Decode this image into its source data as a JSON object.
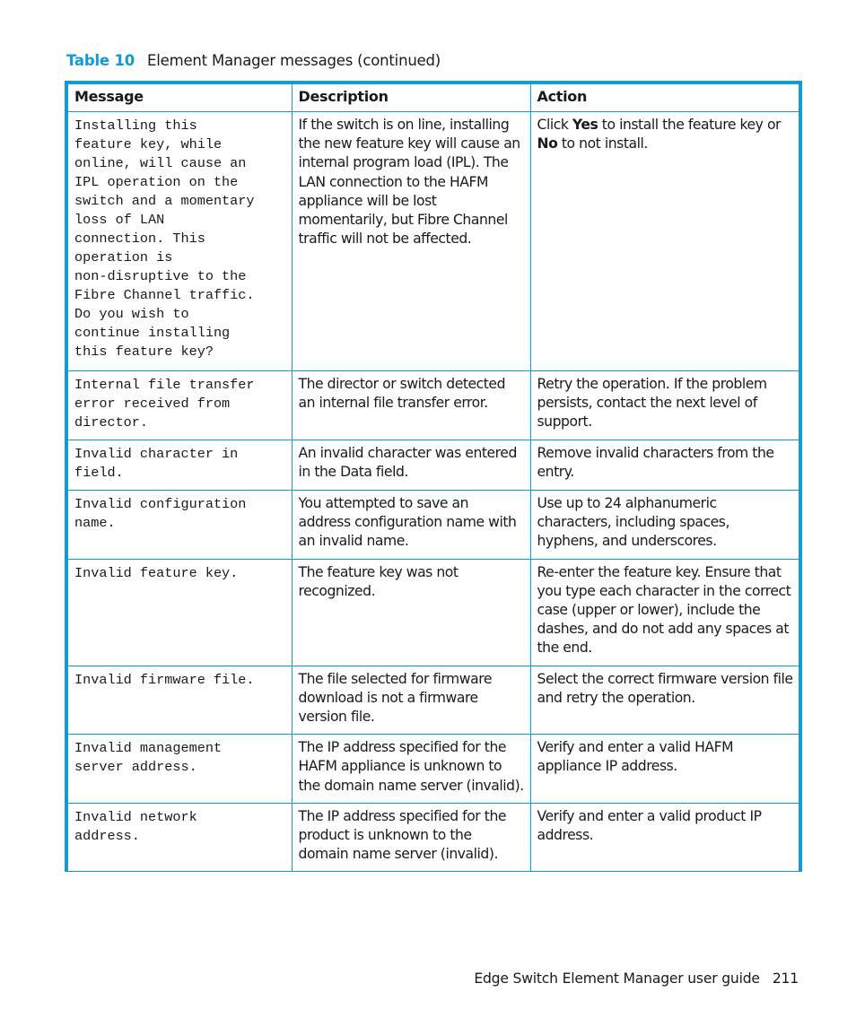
{
  "caption": {
    "table_number": "Table 10",
    "title": "Element Manager messages (continued)"
  },
  "table": {
    "headers": [
      "Message",
      "Description",
      "Action"
    ],
    "rows": [
      {
        "message": "Installing this\nfeature key, while\nonline, will cause an\nIPL operation on the\nswitch and a momentary\nloss of LAN\nconnection. This\noperation is\nnon-disruptive to the\nFibre Channel traffic.\nDo you wish to\ncontinue installing\nthis feature key?",
        "description": "If the switch is on line, installing the new feature key will cause an internal program load (IPL). The LAN connection to the HAFM appliance will be lost momentarily, but Fibre Channel traffic will not be affected.",
        "action_parts": [
          "Click ",
          "Yes",
          " to install the feature key or ",
          "No",
          " to not install."
        ]
      },
      {
        "message": "Internal file transfer\nerror received from\ndirector.",
        "description": "The director or switch detected an internal file transfer error.",
        "action": "Retry the operation. If the problem persists, contact the next level of support."
      },
      {
        "message": "Invalid character in\nfield.",
        "description": "An invalid character was entered in the Data field.",
        "action": "Remove invalid characters from the entry."
      },
      {
        "message": "Invalid configuration\nname.",
        "description": "You attempted to save an address configuration name with an invalid name.",
        "action": "Use up to 24 alphanumeric characters, including spaces, hyphens, and underscores."
      },
      {
        "message": "Invalid feature key.",
        "description": "The feature key was not recognized.",
        "action": "Re-enter the feature key. Ensure that you type each character in the correct case (upper or lower), include the dashes, and do not add any spaces at the end."
      },
      {
        "message": "Invalid firmware file.",
        "description": "The file selected for firmware download is not a firmware version file.",
        "action": "Select the correct firmware version file and retry the operation."
      },
      {
        "message": "Invalid management\nserver address.",
        "description": "The IP address specified for the HAFM appliance is unknown to the domain name server (invalid).",
        "action": "Verify and enter a valid HAFM appliance IP address."
      },
      {
        "message": "Invalid network\naddress.",
        "description": "The IP address specified for the product is unknown to the domain name server (invalid).",
        "action": "Verify and enter a valid product IP address."
      }
    ]
  },
  "footer": {
    "guide_title": "Edge Switch Element Manager user guide",
    "page_number": "211"
  }
}
